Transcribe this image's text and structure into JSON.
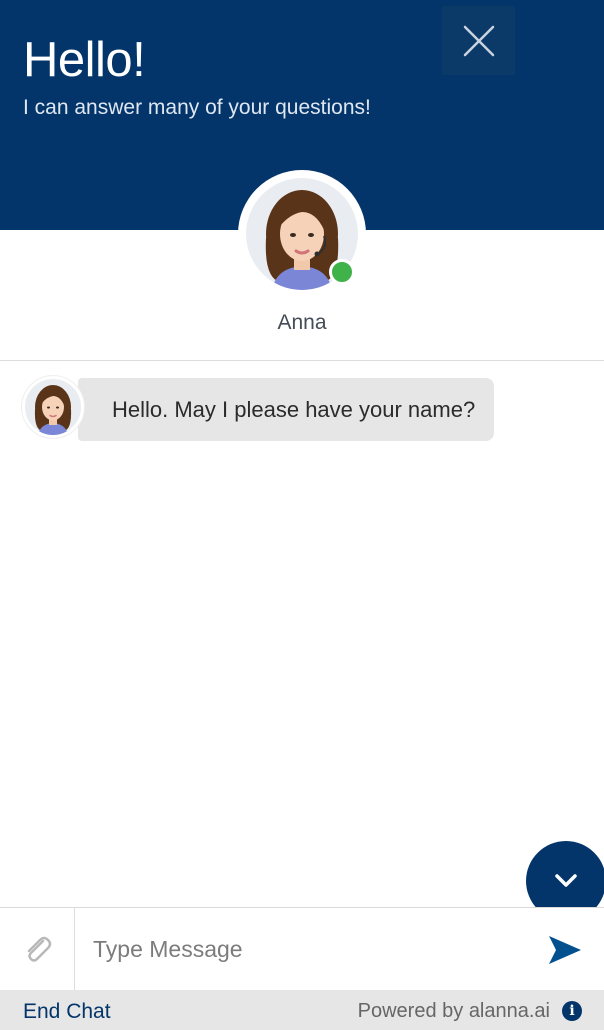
{
  "header": {
    "title": "Hello!",
    "subtitle": "I can answer many of your questions!"
  },
  "agent": {
    "name": "Anna",
    "status": "online"
  },
  "messages": [
    {
      "from": "agent",
      "text": "Hello. May I please have your name?"
    }
  ],
  "composer": {
    "placeholder": "Type Message"
  },
  "footer": {
    "end_chat_label": "End Chat",
    "powered_by": "Powered by alanna.ai"
  },
  "icons": {
    "close": "close-icon",
    "scroll": "chevron-down-icon",
    "attach": "paperclip-icon",
    "send": "send-icon",
    "info": "info-icon"
  },
  "colors": {
    "brand": "#03356a",
    "online": "#3fb24a",
    "bubble": "#e6e6e6"
  }
}
